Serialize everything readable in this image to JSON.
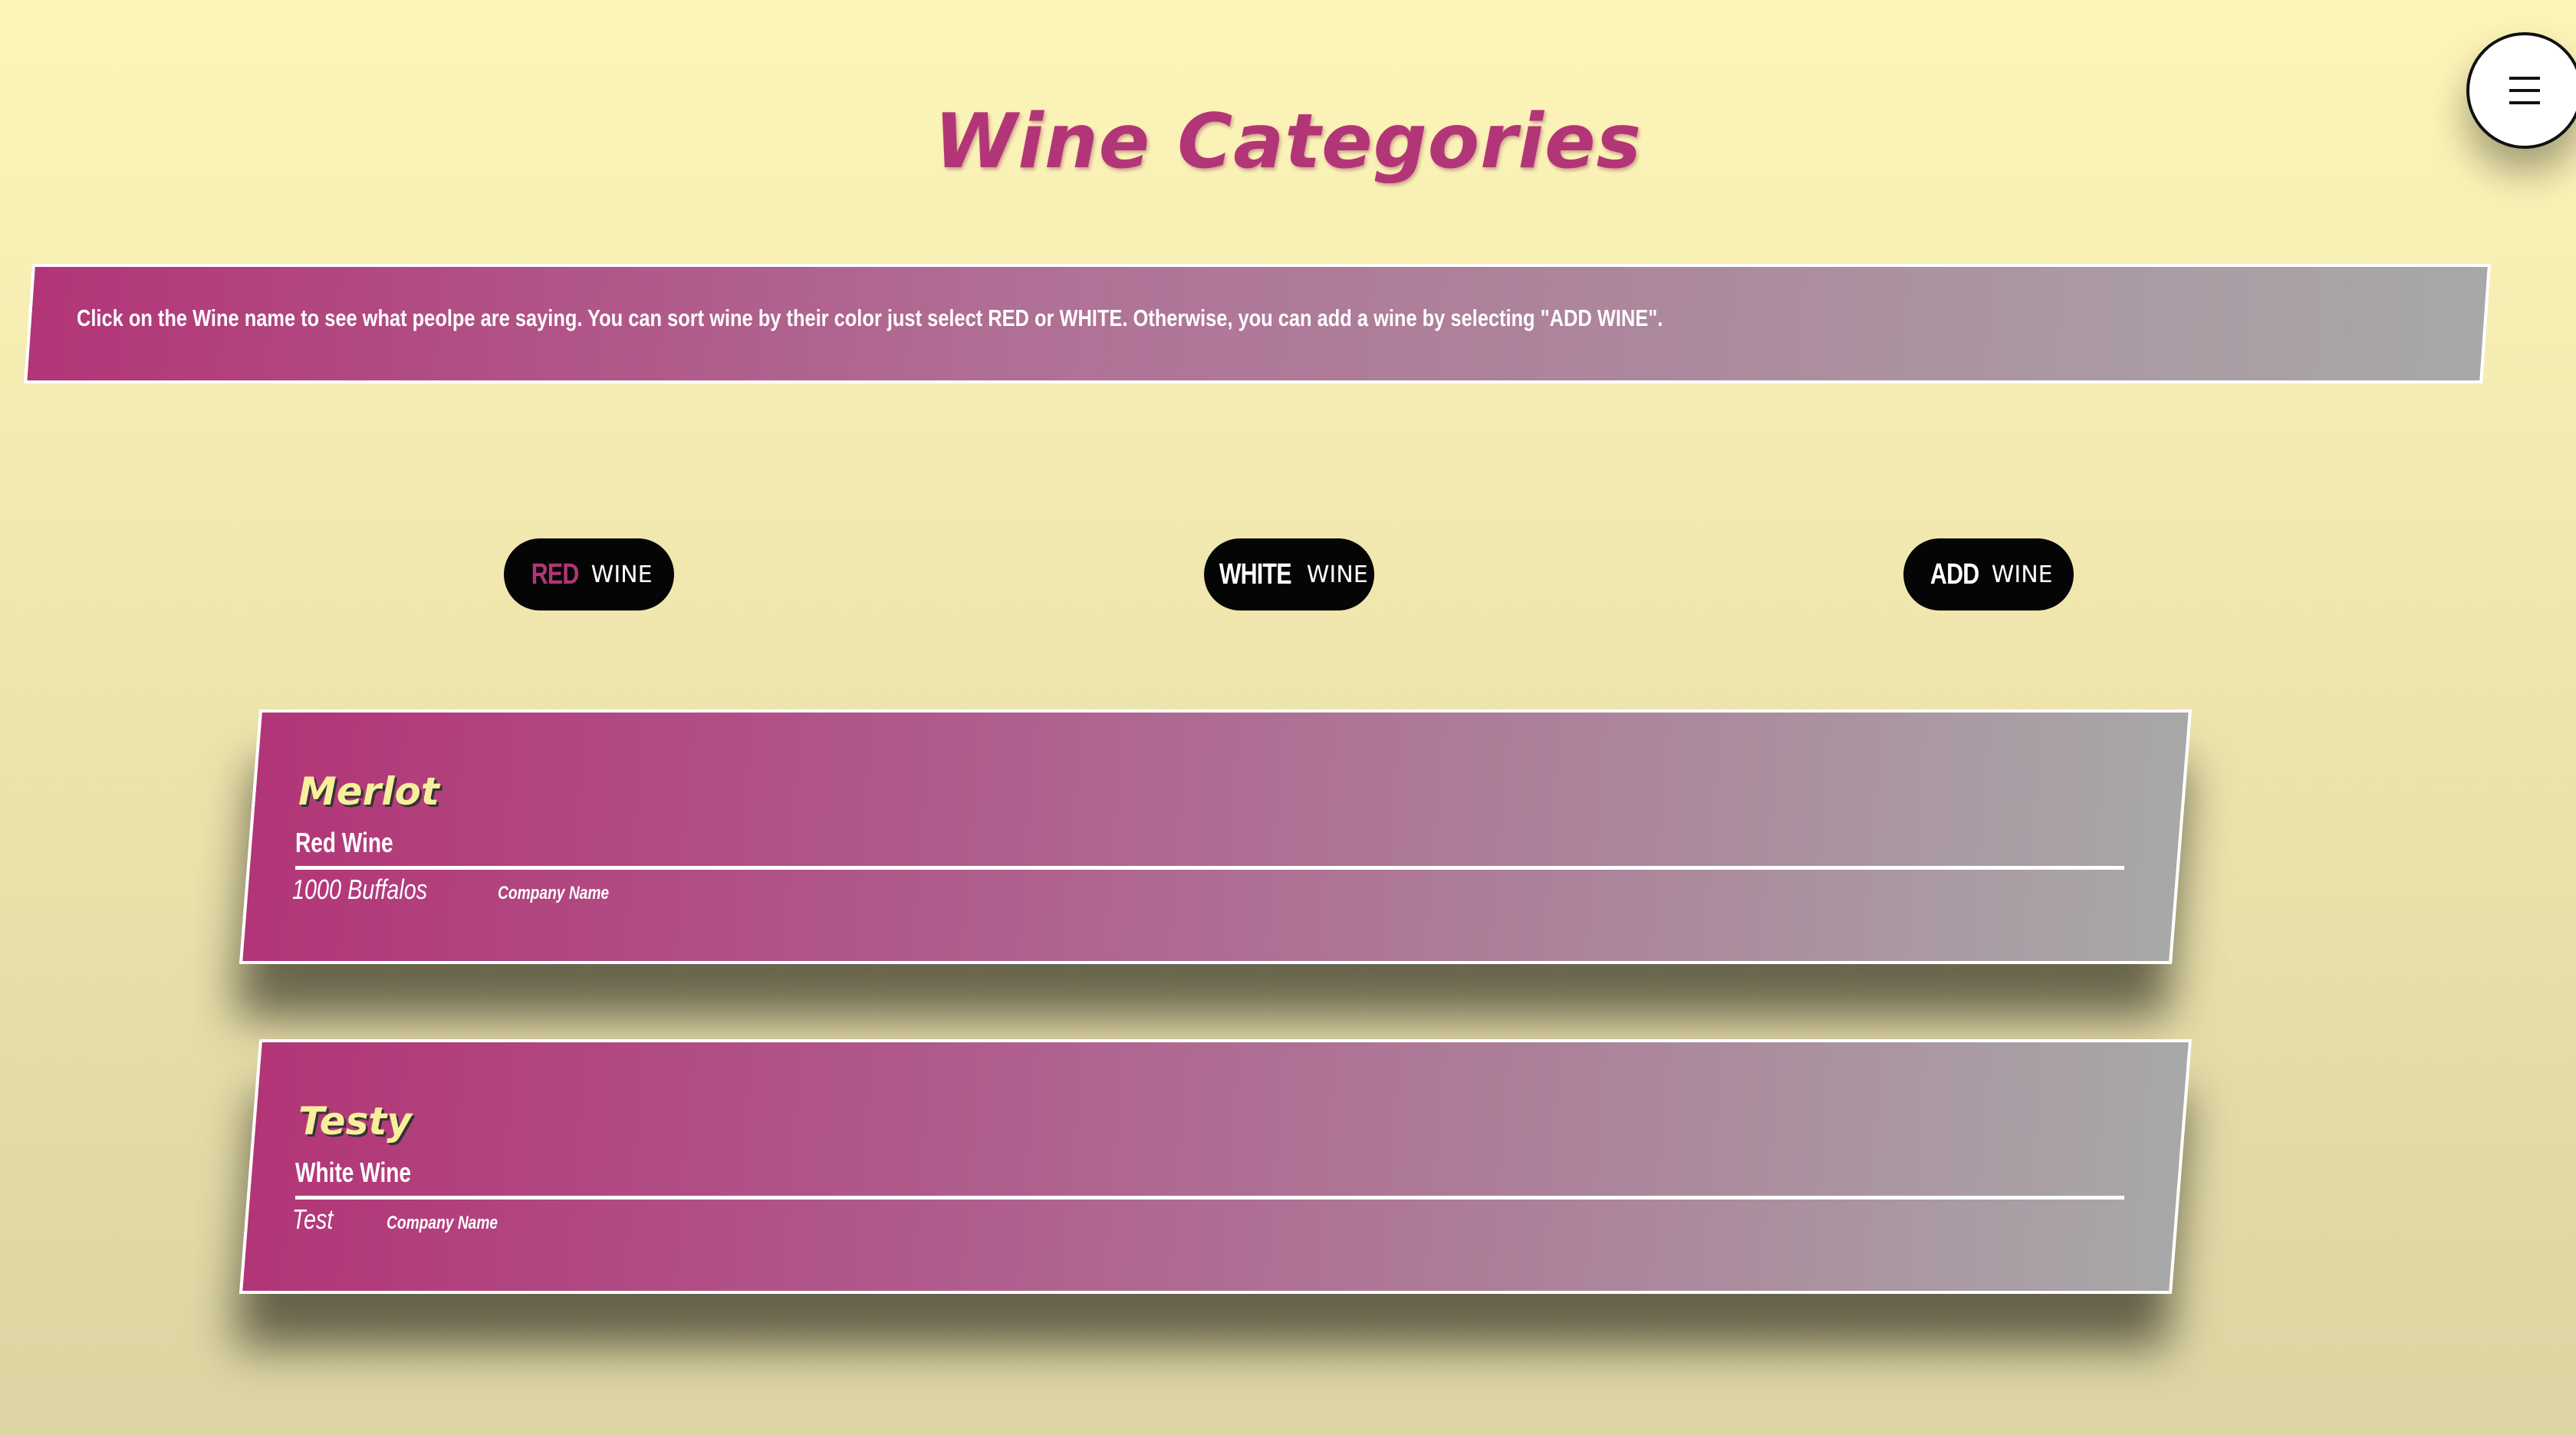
{
  "page": {
    "title": "Wine Categories"
  },
  "menu": {
    "icon": "hamburger-icon"
  },
  "info": {
    "text": "Click on the Wine name to see what peolpe are saying. You can sort wine by their color just select RED or WHITE. Otherwise, you can add a wine by selecting \"ADD WINE\"."
  },
  "filters": [
    {
      "strong": "RED",
      "light": "WINE"
    },
    {
      "strong": "WHITE",
      "light": "WINE"
    },
    {
      "strong": "ADD",
      "light": "WINE"
    }
  ],
  "wines": [
    {
      "name": "Merlot",
      "type": "Red Wine",
      "company": "1000 Buffalos",
      "company_label": "Company Name"
    },
    {
      "name": "Testy",
      "type": "White Wine",
      "company": "Test",
      "company_label": "Company Name"
    }
  ],
  "colors": {
    "accent": "#b23577",
    "background_top": "#fdf5b8",
    "background_bottom": "#dcd4a2",
    "wine_name": "#f8ef9c",
    "button": "#050505"
  }
}
